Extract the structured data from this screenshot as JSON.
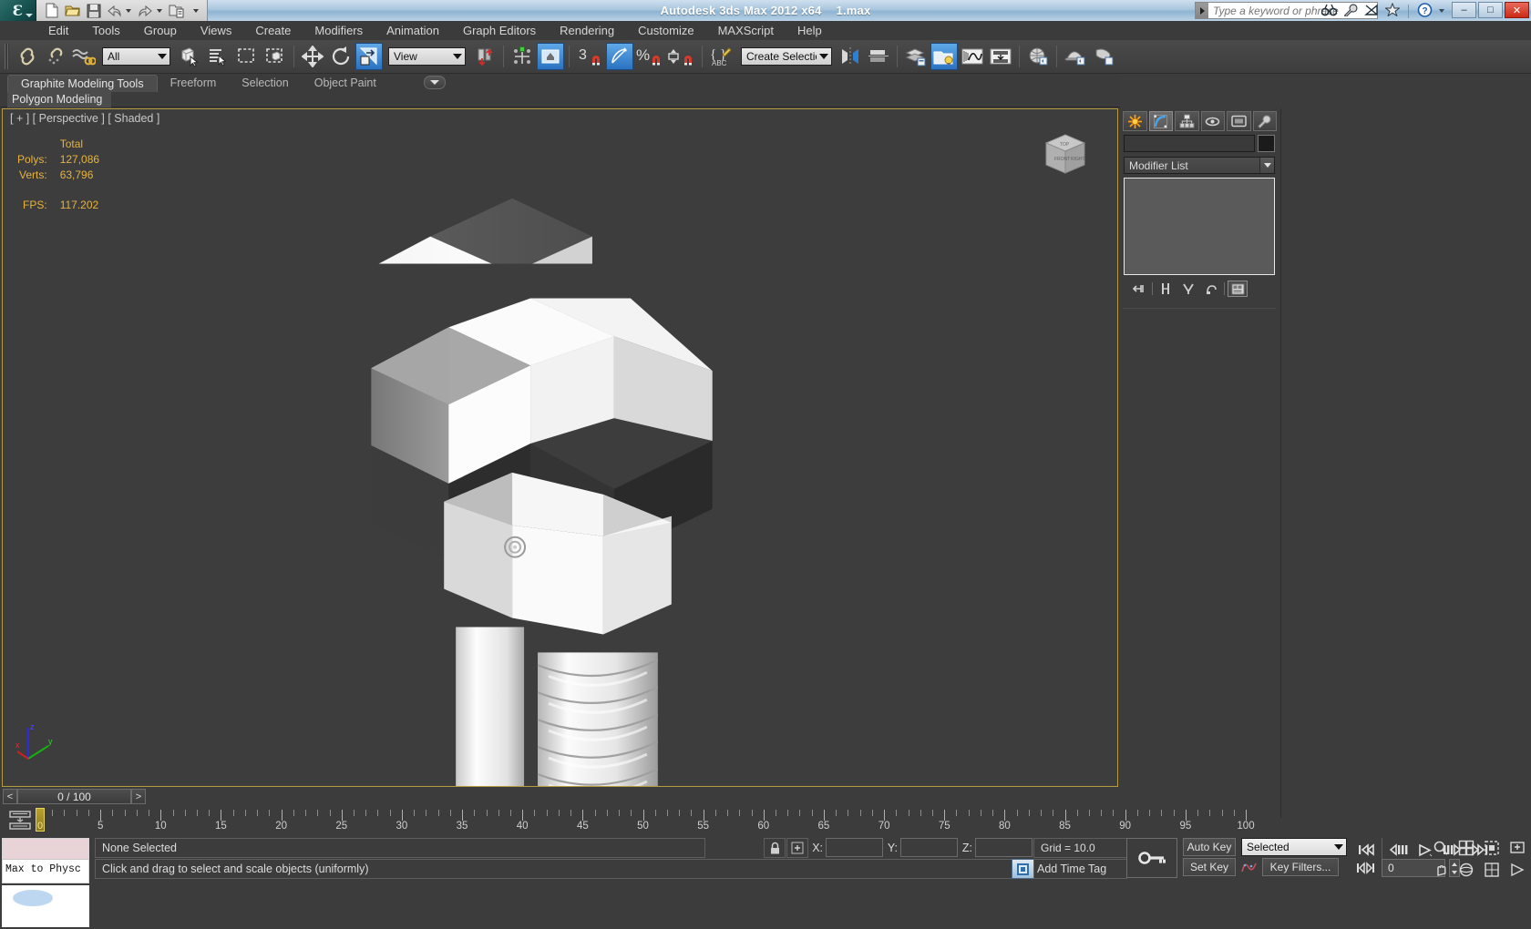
{
  "titlebar": {
    "app_title": "Autodesk 3ds Max  2012 x64",
    "file_name": "1.max",
    "quick_access": [
      "new-icon",
      "open-icon",
      "save-icon",
      "undo-icon",
      "redo-icon",
      "set-project-folder-icon"
    ],
    "search_placeholder": "Type a keyword or phrase",
    "help_icons": [
      "binoculars-icon",
      "wrench-icon",
      "satellite-dish-icon",
      "star-icon",
      "question-icon"
    ],
    "window_buttons": {
      "minimize": "–",
      "maximize": "□",
      "close": "✕"
    }
  },
  "menu": {
    "items": [
      "Edit",
      "Tools",
      "Group",
      "Views",
      "Create",
      "Modifiers",
      "Animation",
      "Graph Editors",
      "Rendering",
      "Customize",
      "MAXScript",
      "Help"
    ]
  },
  "toolbar": {
    "selection_filter": "All",
    "reference_coord_system": "View",
    "named_selection_set": "Create Selection Se",
    "angle_snap_value": "3",
    "icons": [
      "select-link-icon",
      "unlink-icon",
      "bind-space-warp-icon",
      "select-object-icon",
      "select-by-name-icon",
      "rectangular-region-icon",
      "window-crossing-icon",
      "select-and-move-icon",
      "select-and-rotate-icon",
      "select-and-scale-icon",
      "use-pivot-center-icon",
      "mirror-icon",
      "align-icon",
      "snaps-toggle-icon",
      "angle-snap-icon",
      "percent-snap-icon",
      "spinner-snap-icon",
      "named-selection-icon",
      "manage-layers-icon",
      "graphite-toggle-icon",
      "curve-editor-icon",
      "schematic-view-icon",
      "material-editor-icon",
      "render-setup-icon",
      "render-frame-icon",
      "render-production-icon"
    ]
  },
  "ribbon": {
    "tabs": [
      "Graphite Modeling Tools",
      "Freeform",
      "Selection",
      "Object Paint"
    ],
    "selected_tab": "Graphite Modeling Tools",
    "panel_label": "Polygon Modeling"
  },
  "viewport": {
    "label": "[ + ] [ Perspective ] [ Shaded ]",
    "stats": {
      "header": "Total",
      "polys_label": "Polys:",
      "polys_value": "127,086",
      "verts_label": "Verts:",
      "verts_value": "63,796",
      "fps_label": "FPS:",
      "fps_value": "117.202"
    },
    "stats_color": "#e8b33a",
    "border_color": "#b59b3f",
    "axis_labels": {
      "x": "x",
      "y": "y",
      "z": "z"
    },
    "viewcube_faces": {
      "front": "FRONT",
      "right": "RIGHT",
      "top": "TOP"
    }
  },
  "command_panel": {
    "tabs": [
      "create-tab",
      "modify-tab",
      "hierarchy-tab",
      "motion-tab",
      "display-tab",
      "utilities-tab"
    ],
    "selected_tab": "modify-tab",
    "object_name": "",
    "modifier_list_label": "Modifier List",
    "stack_buttons": [
      "pin-stack-icon",
      "show-end-result-icon",
      "make-unique-icon",
      "remove-modifier-icon",
      "configure-modifier-sets-icon"
    ]
  },
  "time_slider": {
    "prev_arrow": "<",
    "next_arrow": ">",
    "current": "0 / 100"
  },
  "track_bar": {
    "start": 0,
    "end": 100,
    "major_step": 5,
    "labels": [
      5,
      10,
      15,
      20,
      25,
      30,
      35,
      40,
      45,
      50,
      55,
      60,
      65,
      70,
      75,
      80,
      85,
      90,
      95,
      100
    ],
    "playhead_label": "0"
  },
  "status_bar": {
    "maxscript_listener": "Max to Physc",
    "selection_status": "None Selected",
    "prompt": "Click and drag to select and scale objects (uniformly)",
    "coords": {
      "x_label": "X:",
      "x_value": "",
      "y_label": "Y:",
      "y_value": "",
      "z_label": "Z:",
      "z_value": ""
    },
    "grid_info": "Grid = 10.0",
    "add_time_tag": "Add Time Tag",
    "lock_icon": "lock-selection-icon",
    "selection_lock_icon": "selection-set-icon"
  },
  "animation": {
    "auto_key": "Auto Key",
    "set_key": "Set Key",
    "key_filters": "Key Filters...",
    "key_mode_selection": "Selected",
    "current_frame": "0",
    "playback_buttons": [
      "go-to-start-icon",
      "previous-frame-icon",
      "play-icon",
      "next-frame-icon",
      "go-to-end-icon",
      "key-mode-toggle-icon"
    ],
    "nav_buttons": [
      "zoom-icon",
      "zoom-all-icon",
      "zoom-extents-icon",
      "zoom-region-icon",
      "pan-icon",
      "orbit-icon",
      "maximize-viewport-icon",
      "field-of-view-icon"
    ]
  }
}
